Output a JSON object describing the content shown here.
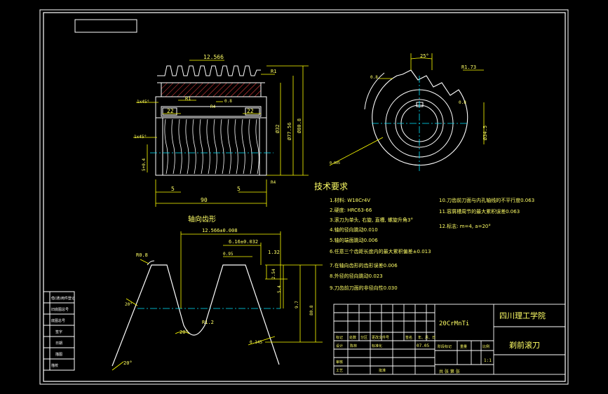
{
  "colors": {
    "background": "#000000",
    "frame": "#ffffff",
    "dimension": "#ffff00",
    "text": "#ffff66",
    "hatch": "#ff4444",
    "center": "#00e5ff",
    "geometry": "#ffffff"
  },
  "top_view": {
    "pitch": "12.566",
    "dims": {
      "d1": "22",
      "d2": "22",
      "L1": "5",
      "L2": "5",
      "L3": "90",
      "tol": "5+0.4",
      "D1": "Ø32",
      "D2": "Ø77.56",
      "D3": "Ø80.8",
      "ch1": "1x45°",
      "ch2": "1x45°",
      "r1": "R1",
      "r2": "R1",
      "val": "0.8",
      "rad": "R4",
      "rad2": "R4"
    }
  },
  "side_view": {
    "angle": "25°",
    "r": "R1.73",
    "d1": "Ø34.5",
    "small": "0.8",
    "small2": "0.8",
    "g": "0.005"
  },
  "tech": {
    "title": "技术要求",
    "left": [
      "1.材料: W18Cr4V",
      "2.硬度: HRC63-66",
      "3.滚刀为单头, 右旋, 直槽, 螺旋升角3°",
      "4.轴的径向跳动0.010",
      "5.轴的端面跳动0.006",
      "6.任意三个齿距长度内的最大累积偏差±0.013",
      "7.在轴向齿形的齿形误差0.006",
      "8.外径的径向跳动0.023",
      "9.刀齿前刀面的非径向性0.030"
    ],
    "right": [
      "10.刀齿前刀面与内孔轴线的不平行度0.063",
      "11.容屑槽周节的最大累积误差0.063",
      "12.标志: m=4, a=20°"
    ]
  },
  "profile": {
    "title": "轴向齿形",
    "dims": {
      "pitch": "12.566±0.008",
      "s": "6.16±0.032",
      "h1": "1.32",
      "h2": "0.95",
      "a1": "2.54",
      "a2": "5.4",
      "a3": "9.7",
      "a4": "80.8",
      "r1": "R0.8",
      "r2": "R1.2",
      "ang": "20°",
      "ang2": "20°",
      "ang3": "20°",
      "fl": "0.145"
    }
  },
  "title_block": {
    "material": "20CrMnTi",
    "school": "四川理工学院",
    "part": "剃前滚刀",
    "scale": "1:1",
    "sheets": "共 张 第 张",
    "row_labels": [
      "标记",
      "处数",
      "分区",
      "更改文件号",
      "签名",
      "年、月、日"
    ],
    "design": "设计",
    "design_name": "陈林",
    "std": "标准化",
    "date": "07.05",
    "stage": "阶段标记",
    "weight": "重量",
    "ratio": "比例",
    "review": "审核",
    "process": "工艺",
    "approve": "批准"
  },
  "side_table": [
    "借(通)用件登记",
    "旧底图总号",
    "底图总号",
    "签字",
    "日期",
    "描图",
    "描校"
  ]
}
